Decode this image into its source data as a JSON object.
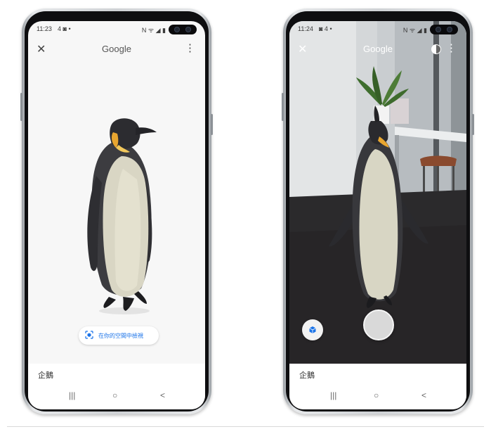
{
  "left_phone": {
    "status": {
      "time": "11:23",
      "icons": "4 ◙ • ",
      "sys": "N ᯤ ◢ ▮"
    },
    "appbar": {
      "close": "✕",
      "title": "Google",
      "more": "⋮"
    },
    "view_button": "在你的空間中檢視",
    "name": "企鵝",
    "nav": {
      "recents": "|||",
      "home": "○",
      "back": "<"
    }
  },
  "right_phone": {
    "status": {
      "time": "11:24",
      "icons": "◙ 4 •",
      "sys": "N ᯤ ◢ ▮"
    },
    "appbar": {
      "close": "✕",
      "title": "Google",
      "more": "⋮"
    },
    "name": "企鵝",
    "nav": {
      "recents": "|||",
      "home": "○",
      "back": "<"
    }
  },
  "colors": {
    "accent": "#1a73e8",
    "panel": "#ffffff"
  },
  "icons": [
    "close-icon",
    "more-vert-icon",
    "cube-icon",
    "shutter-button",
    "ar-toggle-icon"
  ]
}
